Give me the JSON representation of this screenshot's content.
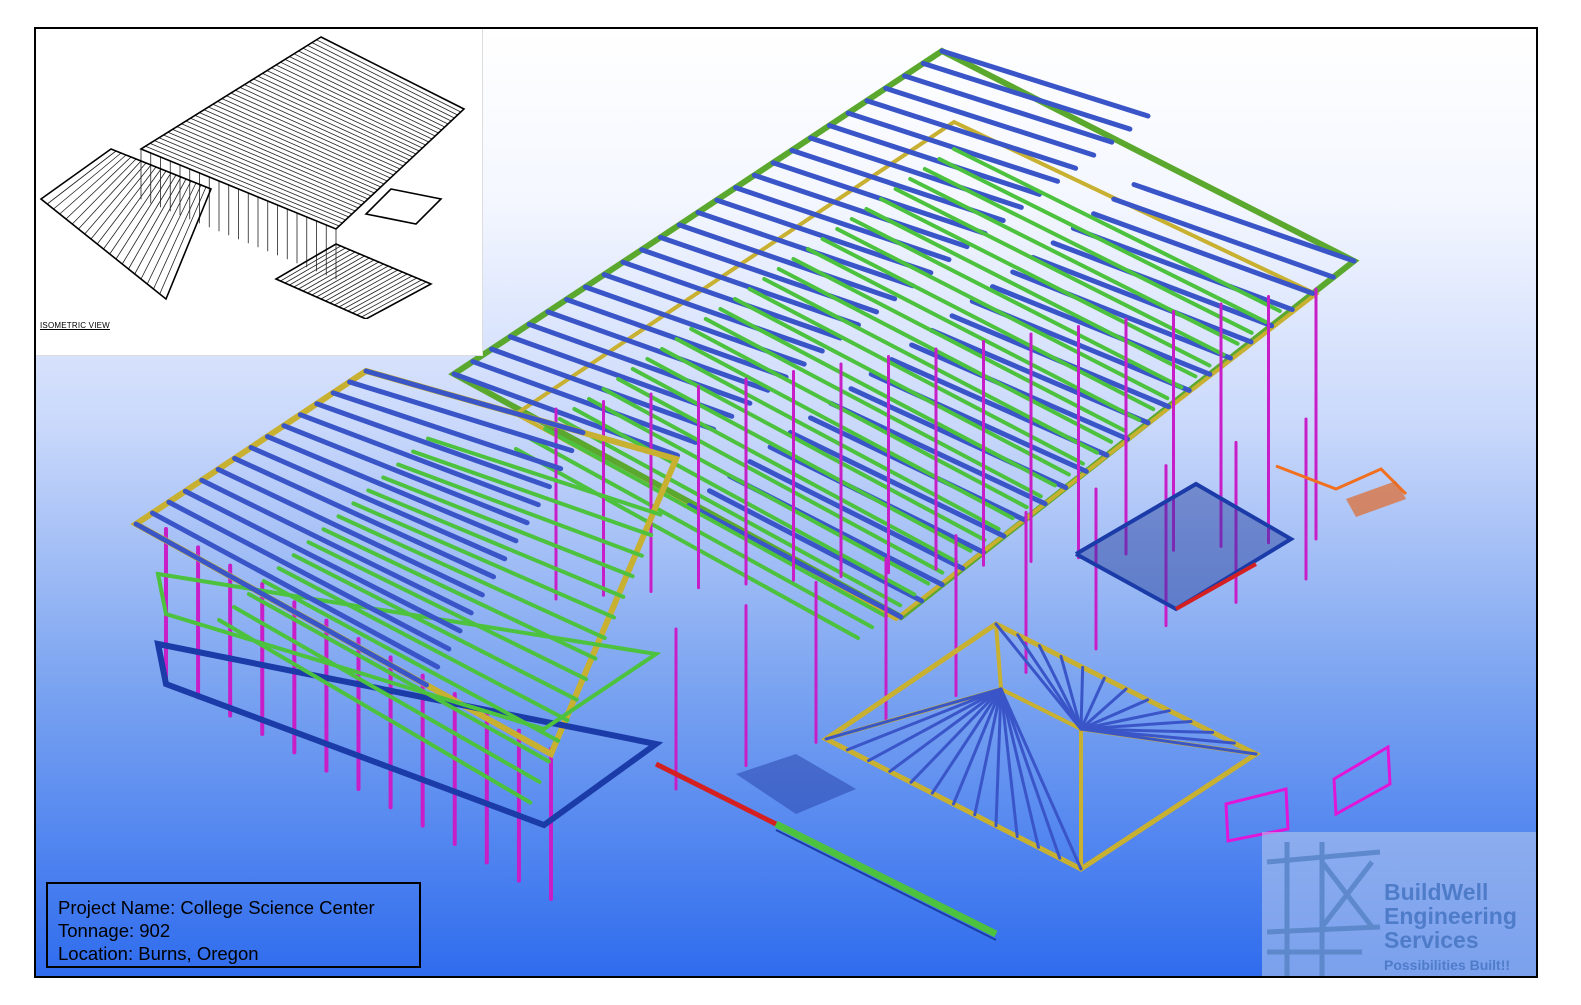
{
  "inset": {
    "caption": "ISOMETRIC VIEW"
  },
  "project": {
    "name_line": "Project Name: College Science Center",
    "tonnage_line": "Tonnage: 902",
    "location_line": "Location: Burns, Oregon"
  },
  "logo": {
    "line1": "BuildWell",
    "line2": "Engineering",
    "line3": "Services",
    "tagline": "Possibilities Built!!"
  },
  "colors": {
    "rafter_blue": "#3a55c8",
    "joist_green": "#4cc23e",
    "column_magenta": "#c81ec8",
    "girder_gold": "#c8b030",
    "beam_red": "#d42020",
    "edge_navy": "#1b3ba8",
    "rail_orange": "#f07020",
    "logo_blue": "#4f7cc9"
  }
}
